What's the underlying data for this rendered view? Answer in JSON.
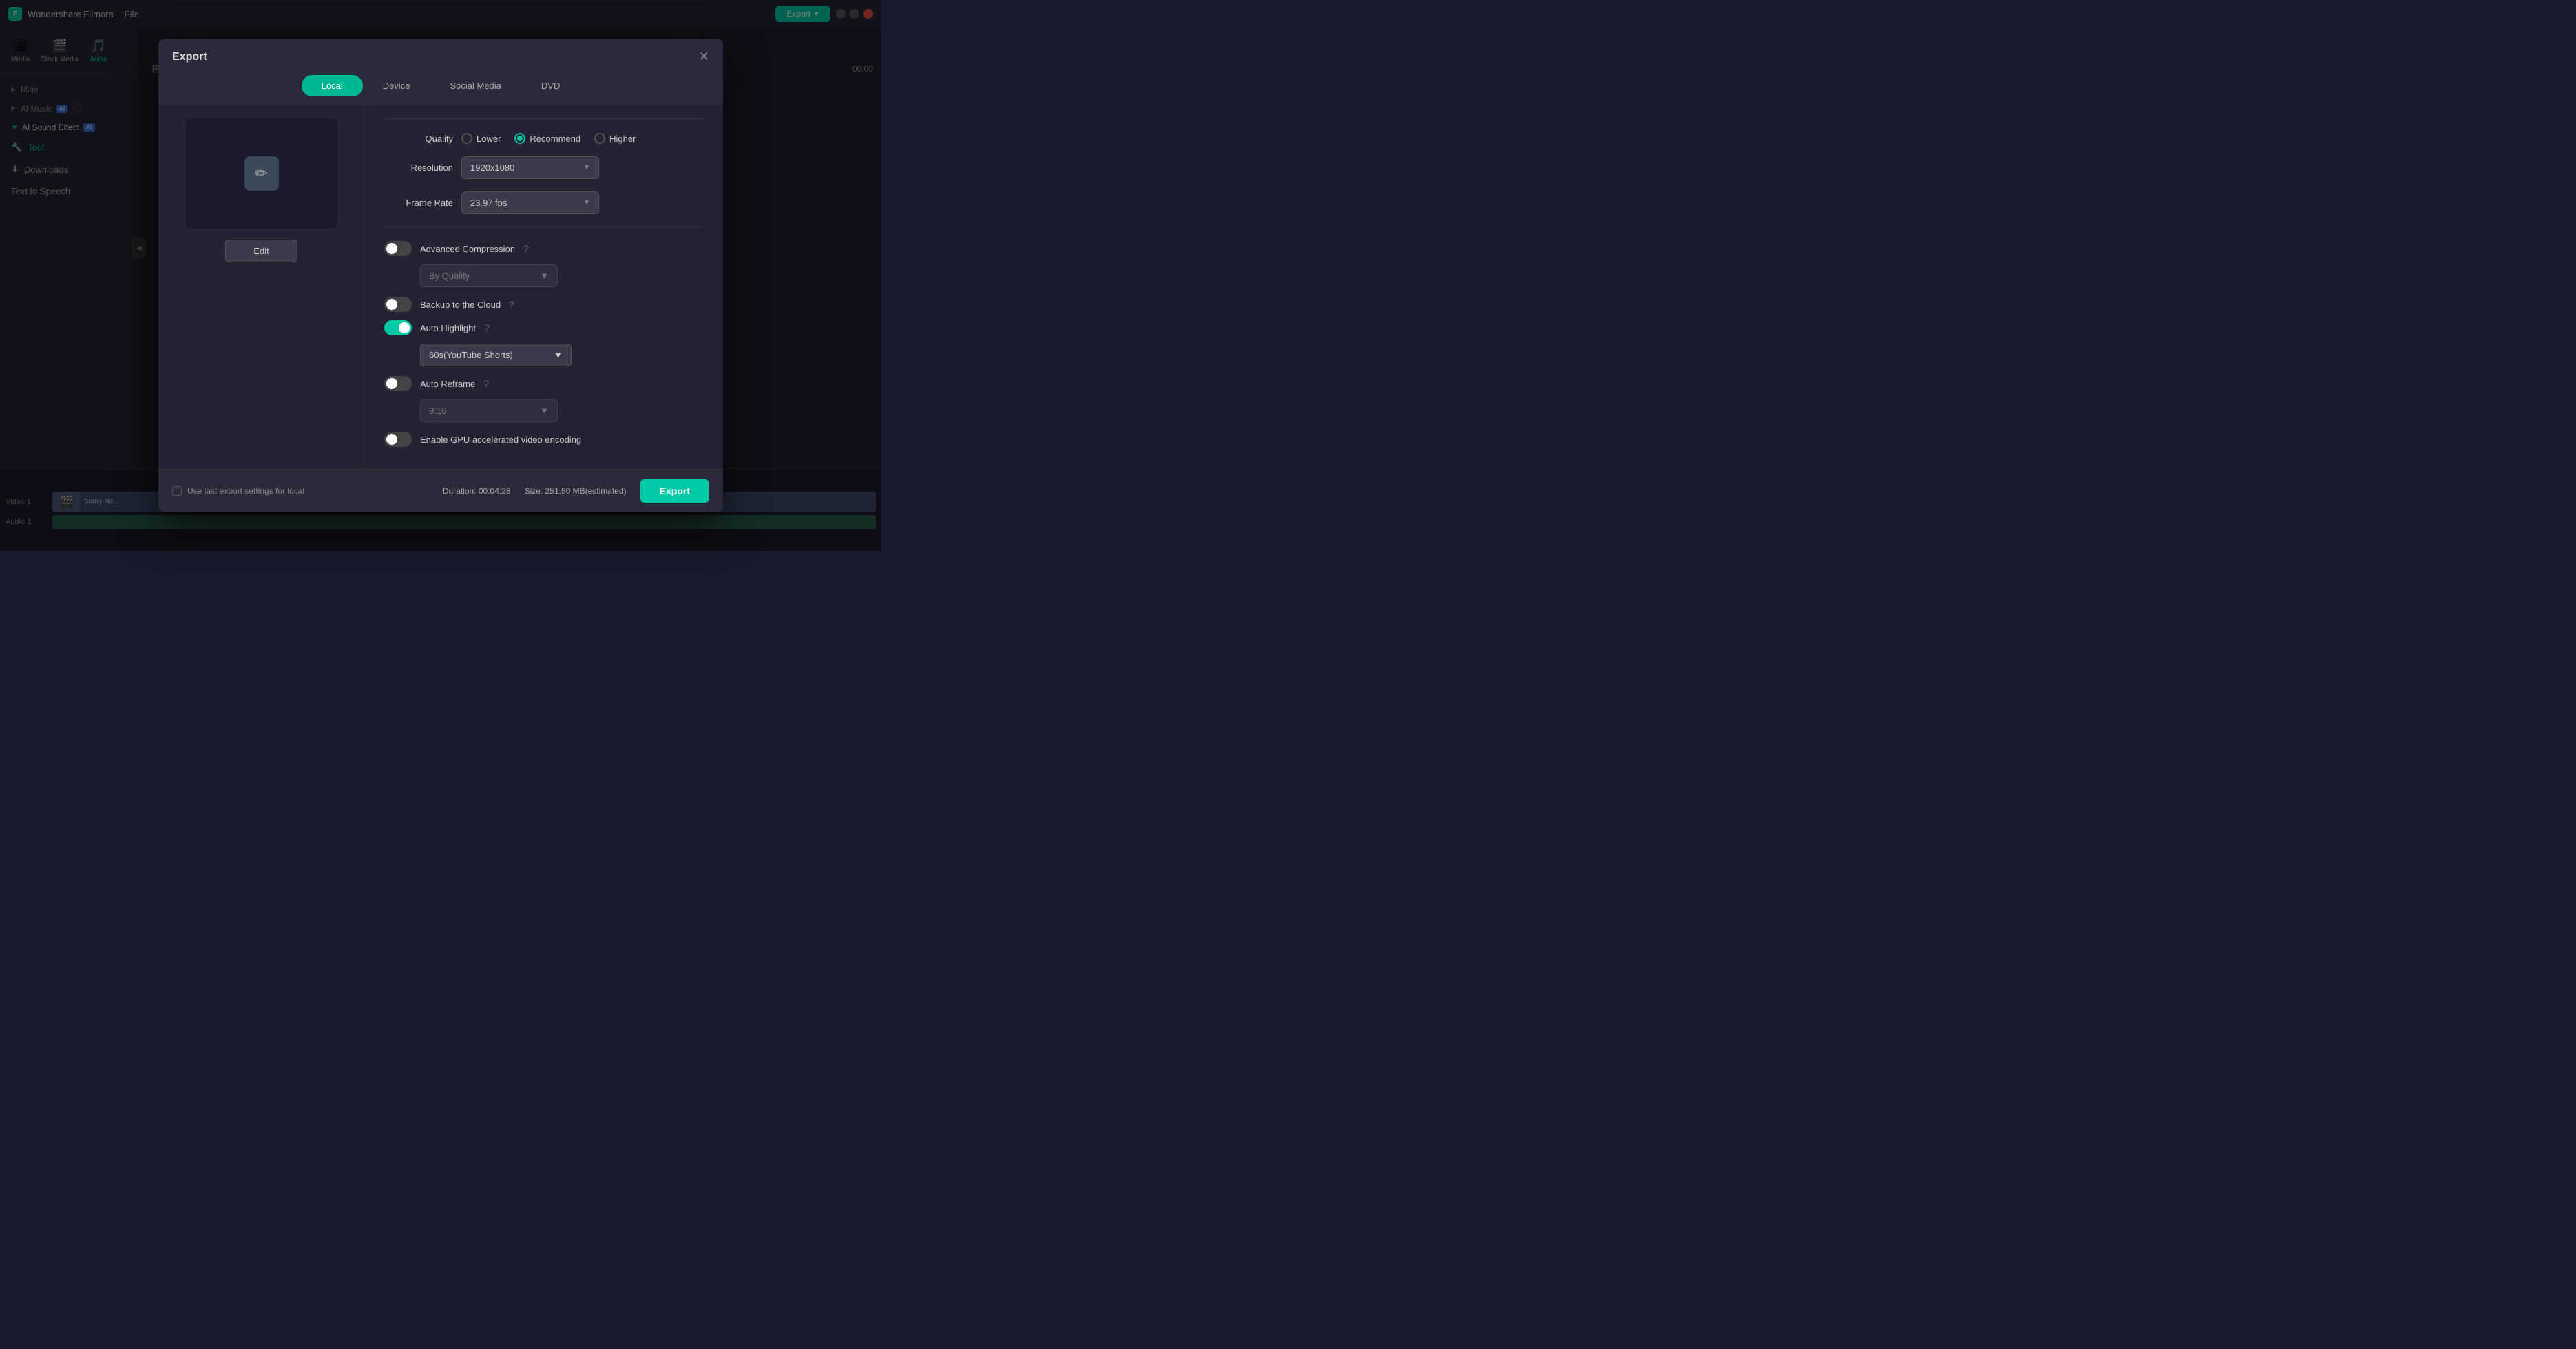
{
  "app": {
    "title": "Wondershare Filmora",
    "menu": "File"
  },
  "titlebar": {
    "logo_text": "F",
    "app_name": "Wondershare Filmora",
    "file_menu": "File"
  },
  "sidebar": {
    "items": [
      {
        "id": "media",
        "label": "Media",
        "icon": "🖼"
      },
      {
        "id": "stock-media",
        "label": "Stock Media",
        "icon": "🎬"
      },
      {
        "id": "audio",
        "label": "Audio",
        "icon": "🎵"
      },
      {
        "id": "mine",
        "label": "Mine",
        "expand": "▶"
      },
      {
        "id": "ai-music",
        "label": "AI Music",
        "badge": "AI"
      },
      {
        "id": "ai-sound-effect",
        "label": "AI Sound Effect",
        "badge": "AI"
      },
      {
        "id": "tool",
        "label": "Tool",
        "icon": "🔧"
      },
      {
        "id": "downloads",
        "label": "Downloads",
        "icon": "⬇"
      },
      {
        "id": "text-to-speech",
        "label": "Text to Speech"
      }
    ]
  },
  "export_dialog": {
    "title": "Export",
    "close_icon": "✕",
    "tabs": [
      {
        "id": "local",
        "label": "Local",
        "active": true
      },
      {
        "id": "device",
        "label": "Device"
      },
      {
        "id": "social-media",
        "label": "Social Media"
      },
      {
        "id": "dvd",
        "label": "DVD"
      }
    ],
    "preview": {
      "edit_button": "Edit"
    },
    "settings": {
      "quality_label": "Quality",
      "quality_options": [
        {
          "id": "lower",
          "label": "Lower",
          "selected": false
        },
        {
          "id": "recommend",
          "label": "Recommend",
          "selected": true
        },
        {
          "id": "higher",
          "label": "Higher",
          "selected": false
        }
      ],
      "resolution_label": "Resolution",
      "resolution_value": "1920x1080",
      "frame_rate_label": "Frame Rate",
      "frame_rate_value": "23.97 fps",
      "advanced_compression_label": "Advanced Compression",
      "advanced_compression_on": false,
      "advanced_compression_help": "?",
      "by_quality_label": "By Quality",
      "backup_cloud_label": "Backup to the Cloud",
      "backup_cloud_on": false,
      "backup_cloud_help": "?",
      "auto_highlight_label": "Auto Highlight",
      "auto_highlight_on": true,
      "auto_highlight_help": "?",
      "auto_highlight_value": "60s(YouTube Shorts)",
      "auto_reframe_label": "Auto Reframe",
      "auto_reframe_on": false,
      "auto_reframe_help": "?",
      "auto_reframe_value": "9:16",
      "gpu_label": "Enable GPU accelerated video encoding",
      "gpu_on": false
    },
    "footer": {
      "checkbox_label": "Use last export settings for local",
      "duration_label": "Duration: 00:04:28",
      "size_label": "Size: 251.50 MB(estimated)",
      "export_button": "Export"
    }
  },
  "toolbar": {
    "time_display": "00:00"
  },
  "timeline": {
    "video_track_label": "Video 1",
    "audio_track_label": "Audio 1",
    "clip_name": "Starry Ne..."
  }
}
